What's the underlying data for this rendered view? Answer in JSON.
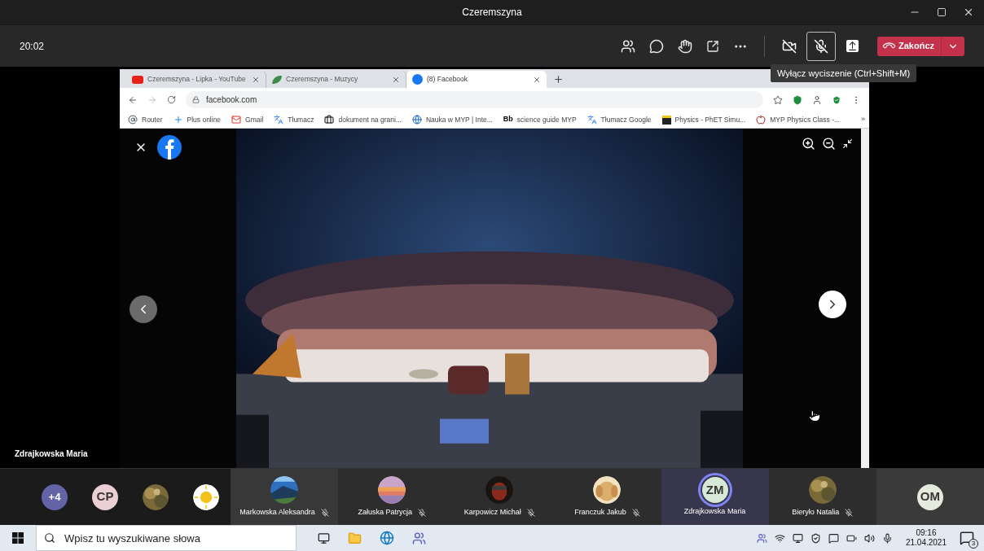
{
  "window": {
    "title": "Czeremszyna"
  },
  "call_bar": {
    "time": "20:02",
    "camera": {
      "on": false
    },
    "mic": {
      "on": false
    },
    "end_button": "Zakończ",
    "tooltip": "Wyłącz wyciszenie (Ctrl+Shift+M)"
  },
  "browser": {
    "tabs": [
      {
        "label": "Czeremszyna - Lipka - YouTube",
        "selected": false
      },
      {
        "label": "Czeremszyna - Muzycy",
        "selected": false
      },
      {
        "label": "(8) Facebook",
        "selected": true
      }
    ],
    "address": "facebook.com",
    "bookmarks": [
      {
        "label": "Router"
      },
      {
        "label": "Plus online"
      },
      {
        "label": "Gmail"
      },
      {
        "label": "Tłumacz"
      },
      {
        "label": "dokument na grani..."
      },
      {
        "label": "Nauka w MYP | Inte..."
      },
      {
        "label": "science guide MYP",
        "mark": "Bb"
      },
      {
        "label": "Tłumacz Google"
      },
      {
        "label": "Physics - PhET Simu..."
      },
      {
        "label": "MYP Physics Class -..."
      }
    ],
    "bookmarks_more": "»"
  },
  "presenter": "Zdrajkowska Maria",
  "overflow": [
    {
      "kind": "initials",
      "label": "+4",
      "color": "#6264a7"
    },
    {
      "kind": "initials",
      "label": "CP",
      "color": "#ead0d5"
    },
    {
      "kind": "picture"
    },
    {
      "kind": "picture"
    }
  ],
  "tiles": [
    {
      "kind": "picture",
      "name": "Markowska Aleksandra",
      "muted": true,
      "speaking": false
    },
    {
      "kind": "picture",
      "name": "Załuska Patrycja",
      "muted": true,
      "speaking": false
    },
    {
      "kind": "picture",
      "name": "Karpowicz Michał",
      "muted": true,
      "speaking": false
    },
    {
      "kind": "picture",
      "name": "Franczuk Jakub",
      "muted": true,
      "speaking": false
    },
    {
      "kind": "initials",
      "label": "ZM",
      "color": "#d6e8d6",
      "name": "Zdrajkowska Maria",
      "muted": false,
      "speaking": true
    },
    {
      "kind": "picture",
      "name": "Bieryło Natalia",
      "muted": true,
      "speaking": false
    },
    {
      "kind": "initials",
      "label": "OM",
      "color": "#e4ebdc"
    }
  ],
  "taskbar": {
    "search_placeholder": "Wpisz tu wyszukiwane słowa",
    "time": "09:16",
    "date": "21.04.2021",
    "notifications": "3"
  }
}
